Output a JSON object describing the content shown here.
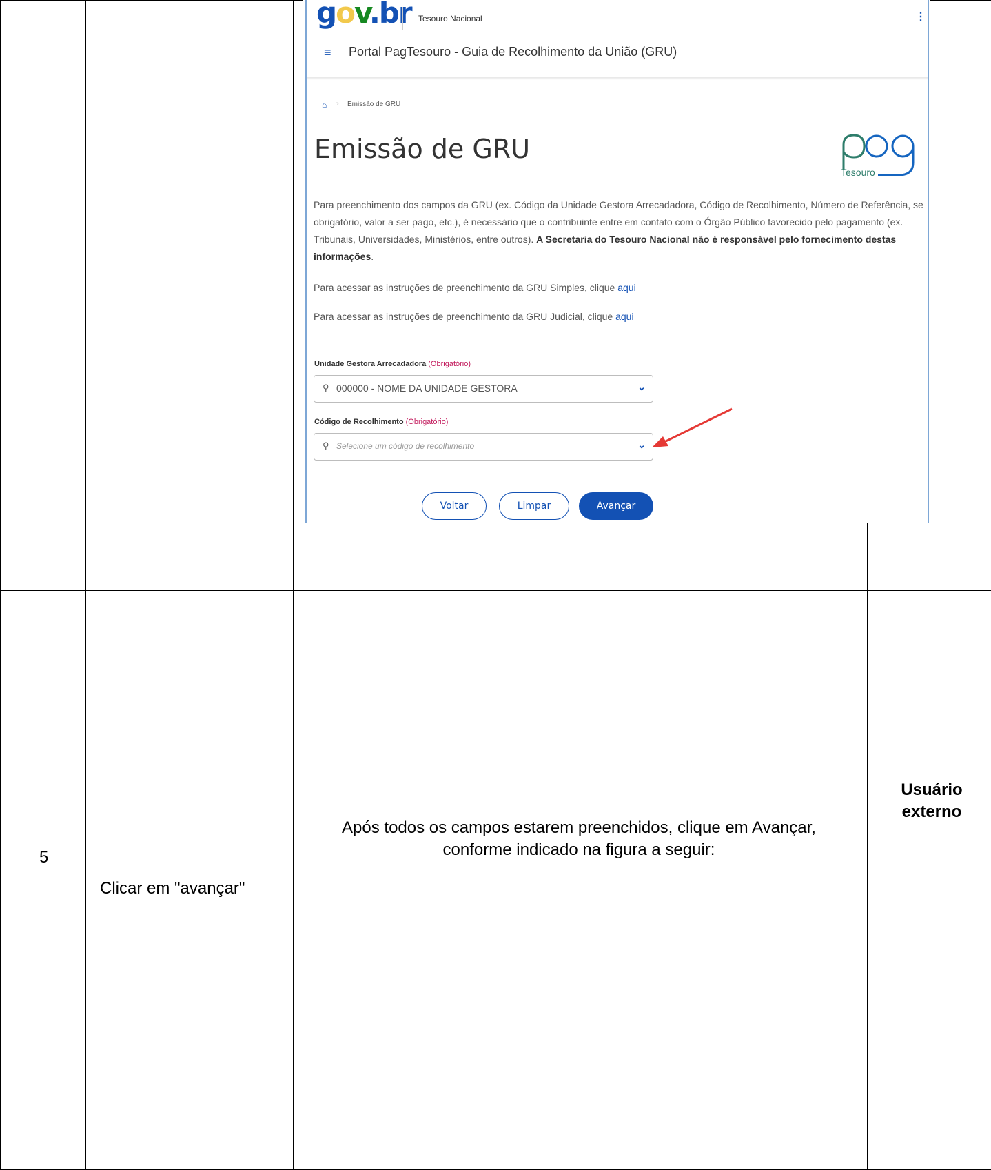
{
  "screenshot": {
    "gov_logo": {
      "g": "g",
      "o": "o",
      "v": "v",
      "dot": ".",
      "br": "br"
    },
    "org_name": "Tesouro Nacional",
    "portal_title": "Portal PagTesouro - Guia de Recolhimento da União (GRU)",
    "breadcrumb": "Emissão de GRU",
    "page_title": "Emissão de GRU",
    "pag_logo": {
      "top": "pag",
      "bottom": "Tesouro"
    },
    "intro": "Para preenchimento dos campos da GRU (ex. Código da Unidade Gestora Arrecadadora, Código de Recolhimento, Número de Referência, se obrigatório, valor a ser pago, etc.), é necessário que o contribuinte entre em contato com o Órgão Público favorecido pelo pagamento (ex. Tribunais, Universidades, Ministérios, entre outros).",
    "intro_bold": "A Secretaria do Tesouro Nacional não é responsável pelo fornecimento destas informações",
    "intro_end": ".",
    "simple_text": "Para acessar as instruções de preenchimento da GRU Simples, clique",
    "judicial_text": "Para acessar as instruções de preenchimento da GRU Judicial, clique",
    "link_label": "aqui",
    "ug_label": "Unidade Gestora Arrecadadora",
    "required_tag": "(Obrigatório)",
    "ug_value": "000000 - NOME DA UNIDADE GESTORA",
    "cr_label": "Código de Recolhimento",
    "cr_placeholder": "Selecione um código de recolhimento",
    "buttons": {
      "back": "Voltar",
      "clear": "Limpar",
      "next": "Avançar"
    }
  },
  "row5": {
    "step": "5",
    "action": "Clicar em \"avançar\"",
    "description": "Após todos os campos estarem preenchidos, clique em Avançar, conforme indicado na figura a seguir:",
    "actor": "Usuário externo"
  },
  "colors": {
    "gov_blue": "#1351b4",
    "required_red": "#c2185b",
    "arrow_red": "#e53935"
  }
}
